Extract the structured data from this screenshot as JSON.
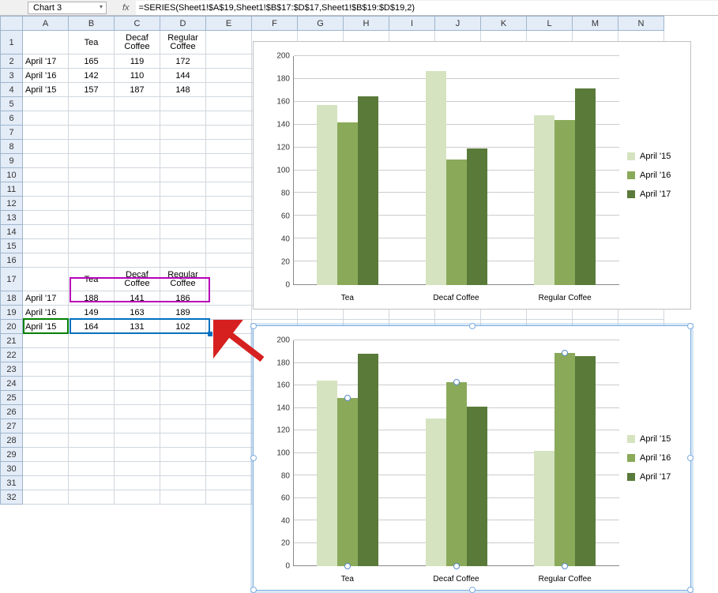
{
  "name_box": "Chart 3",
  "fx_label": "fx",
  "formula": "=SERIES(Sheet1!$A$19,Sheet1!$B$17:$D$17,Sheet1!$B$19:$D$19,2)",
  "columns": [
    "A",
    "B",
    "C",
    "D",
    "E",
    "F",
    "G",
    "H",
    "I",
    "J",
    "K",
    "L",
    "M",
    "N"
  ],
  "rows": [
    "1",
    "2",
    "3",
    "4",
    "5",
    "6",
    "7",
    "8",
    "9",
    "10",
    "11",
    "12",
    "13",
    "14",
    "15",
    "16",
    "17",
    "18",
    "19",
    "20",
    "21",
    "22",
    "23",
    "24",
    "25",
    "26",
    "27",
    "28",
    "29",
    "30",
    "31",
    "32"
  ],
  "table1": {
    "header_row": 1,
    "headers": [
      "",
      "Tea",
      "Decaf Coffee",
      "Regular Coffee"
    ],
    "rows": [
      {
        "r": 2,
        "label": "April '17",
        "vals": [
          165,
          119,
          172
        ]
      },
      {
        "r": 3,
        "label": "April '16",
        "vals": [
          142,
          110,
          144
        ]
      },
      {
        "r": 4,
        "label": "April '15",
        "vals": [
          157,
          187,
          148
        ]
      }
    ]
  },
  "table2": {
    "header_row": 17,
    "headers": [
      "",
      "Tea",
      "Decaf Coffee",
      "Regular Coffee"
    ],
    "rows": [
      {
        "r": 18,
        "label": "April '17",
        "vals": [
          188,
          141,
          186
        ]
      },
      {
        "r": 19,
        "label": "April '16",
        "vals": [
          149,
          163,
          189
        ]
      },
      {
        "r": 20,
        "label": "April '15",
        "vals": [
          164,
          131,
          102
        ]
      }
    ]
  },
  "legend": [
    "April '15",
    "April '16",
    "April '17"
  ],
  "chart_data": [
    {
      "type": "bar",
      "categories": [
        "Tea",
        "Decaf Coffee",
        "Regular Coffee"
      ],
      "series": [
        {
          "name": "April '15",
          "values": [
            157,
            187,
            148
          ]
        },
        {
          "name": "April '16",
          "values": [
            142,
            110,
            144
          ]
        },
        {
          "name": "April '17",
          "values": [
            165,
            119,
            172
          ]
        }
      ],
      "ylim": [
        0,
        200
      ],
      "ystep": 20,
      "title": "",
      "xlabel": "",
      "ylabel": ""
    },
    {
      "type": "bar",
      "categories": [
        "Tea",
        "Decaf Coffee",
        "Regular Coffee"
      ],
      "series": [
        {
          "name": "April '15",
          "values": [
            164,
            131,
            102
          ]
        },
        {
          "name": "April '16",
          "values": [
            149,
            163,
            189
          ]
        },
        {
          "name": "April '17",
          "values": [
            188,
            141,
            186
          ]
        }
      ],
      "ylim": [
        0,
        200
      ],
      "ystep": 20,
      "title": "",
      "xlabel": "",
      "ylabel": ""
    }
  ]
}
